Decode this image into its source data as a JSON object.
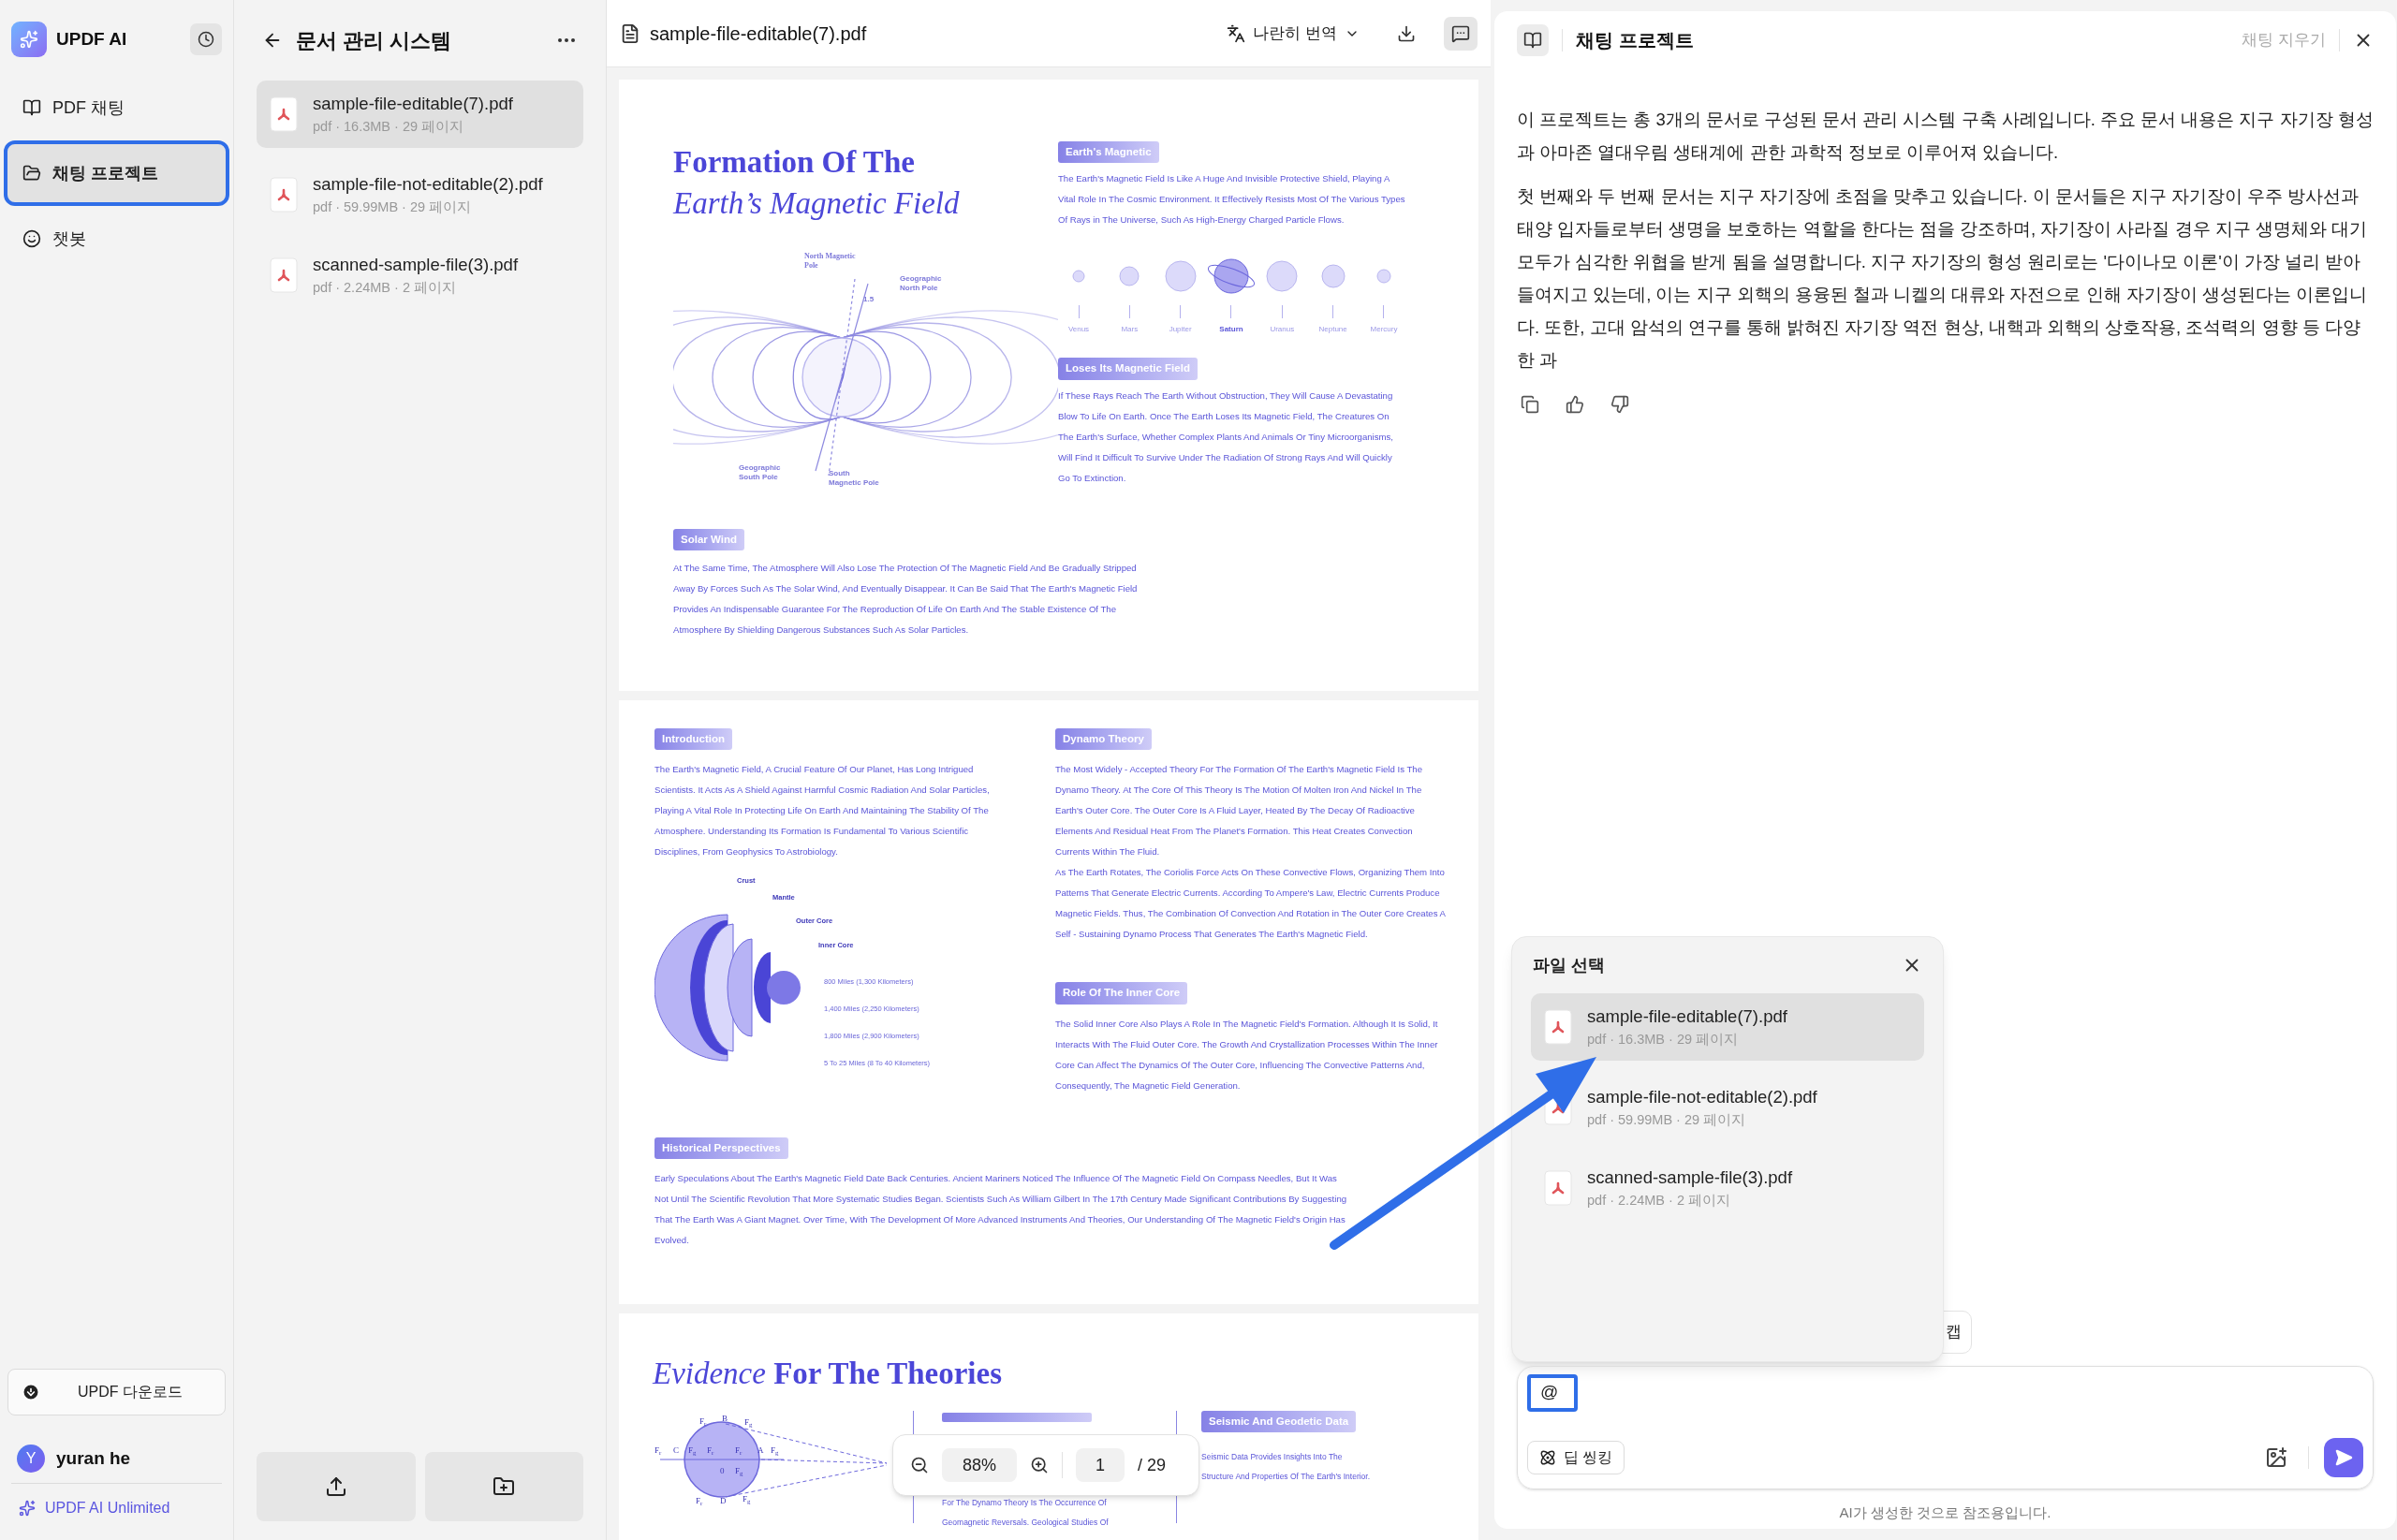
{
  "sidebar": {
    "app_name": "UPDF AI",
    "items": [
      {
        "label": "PDF 채팅",
        "kind": "book",
        "selected": false
      },
      {
        "label": "채팅 프로젝트",
        "kind": "folder",
        "selected": true
      },
      {
        "label": "챗봇",
        "kind": "bot",
        "selected": false
      }
    ],
    "download_button": "UPDF 다운로드",
    "user": {
      "initial": "Y",
      "name": "yuran he"
    },
    "plan": "UPDF AI Unlimited"
  },
  "project": {
    "title": "문서 관리 시스템",
    "files": [
      {
        "name": "sample-file-editable(7).pdf",
        "meta": "pdf · 16.3MB · 29 페이지",
        "selected": true
      },
      {
        "name": "sample-file-not-editable(2).pdf",
        "meta": "pdf · 59.99MB · 29 페이지",
        "selected": false
      },
      {
        "name": "scanned-sample-file(3).pdf",
        "meta": "pdf · 2.24MB · 2 페이지",
        "selected": false
      }
    ]
  },
  "viewer": {
    "file_name": "sample-file-editable(7).pdf",
    "translate_button": "나란히 번역",
    "zoom": "88%",
    "page": "1",
    "page_total": "/ 29",
    "page1": {
      "title": "Formation Of The",
      "subtitle": "Earth’s Magnetic Field",
      "diagram_labels": [
        "North Magnetic Pole",
        "Geographic North Pole",
        "1.5",
        "Geographic South Pole",
        "South Magnetic Pole"
      ],
      "sections": [
        {
          "heading": "Earth's Magnetic",
          "text": "The Earth's Magnetic Field Is Like A Huge And Invisible Protective Shield, Playing A Vital Role In The Cosmic Environment. It Effectively Resists Most Of The Various Types Of Rays in The Universe, Such As High-Energy Charged Particle Flows."
        },
        {
          "heading": "Loses Its Magnetic Field",
          "text": "If These Rays Reach The Earth Without Obstruction, They Will Cause A Devastating Blow To Life On Earth. Once The Earth Loses Its Magnetic Field, The Creatures On The Earth's Surface, Whether Complex Plants And Animals Or Tiny Microorganisms, Will Find It Difficult To Survive Under The Radiation Of Strong Rays And Will Quickly Go To Extinction."
        },
        {
          "heading": "Solar Wind",
          "text": "At The Same Time, The Atmosphere Will Also Lose The Protection Of The Magnetic Field And Be Gradually Stripped Away By Forces Such As The Solar Wind, And Eventually Disappear. It Can Be Said That The Earth's Magnetic Field Provides An Indispensable Guarantee For The Reproduction Of Life On Earth And The Stable Existence Of The Atmosphere By Shielding Dangerous Substances Such As Solar Particles."
        }
      ],
      "planets": [
        {
          "name": "Venus",
          "highlighted": false
        },
        {
          "name": "Mars",
          "highlighted": false
        },
        {
          "name": "Jupiter",
          "highlighted": false
        },
        {
          "name": "Saturn",
          "highlighted": true
        },
        {
          "name": "Uranus",
          "highlighted": false
        },
        {
          "name": "Neptune",
          "highlighted": false
        },
        {
          "name": "Mercury",
          "highlighted": false
        }
      ]
    },
    "page2": {
      "sections": [
        {
          "heading": "Introduction",
          "paragraphs": [
            "The Earth's Magnetic Field, A Crucial Feature Of Our Planet, Has Long Intrigued Scientists. It Acts As A Shield Against Harmful Cosmic Radiation And Solar Particles, Playing A Vital Role In Protecting Life On Earth And Maintaining The Stability Of The Atmosphere. Understanding Its Formation Is Fundamental To Various Scientific Disciplines, From Geophysics To Astrobiology."
          ]
        },
        {
          "heading": "Dynamo Theory",
          "paragraphs": [
            "The Most Widely - Accepted Theory For The Formation Of The Earth's Magnetic Field Is The Dynamo Theory. At The Core Of This Theory Is The Motion Of Molten Iron And Nickel In The Earth's Outer Core. The Outer Core Is A Fluid Layer, Heated By The Decay Of Radioactive Elements And Residual Heat From The Planet's Formation. This Heat Creates Convection Currents Within The Fluid.",
            "As The Earth Rotates, The Coriolis Force Acts On These Convective Flows, Organizing Them Into Patterns That Generate Electric Currents. According To Ampere's Law, Electric Currents Produce Magnetic Fields. Thus, The Combination Of Convection And Rotation in The Outer Core Creates A Self - Sustaining Dynamo Process That Generates The Earth's Magnetic Field."
          ]
        },
        {
          "heading": "Role Of The Inner Core",
          "paragraphs": [
            "The Solid Inner Core Also Plays A Role In The Magnetic Field's Formation. Although It Is Solid, It Interacts With The Fluid Outer Core. The Growth And Crystallization Processes Within The Inner Core Can Affect The Dynamics Of The Outer Core, Influencing The Convective Patterns And, Consequently, The Magnetic Field Generation."
          ]
        },
        {
          "heading": "Historical Perspectives",
          "paragraphs": [
            "Early Speculations About The Earth's Magnetic Field Date Back Centuries. Ancient Mariners Noticed The Influence Of The Magnetic Field On Compass Needles, But It Was Not Until The Scientific Revolution That More Systematic Studies Began. Scientists Such As William Gilbert In The 17th Century Made Significant Contributions By Suggesting That The Earth Was A Giant Magnet. Over Time, With The Development Of More Advanced Instruments And Theories, Our Understanding Of The Magnetic Field's Origin Has Evolved."
          ]
        }
      ],
      "layer_labels": [
        "Crust",
        "Mantle",
        "Outer Core",
        "Inner Core"
      ],
      "distances": [
        "800 Miles (1,300 Kilometers)",
        "1,400 Miles (2,250 Kilometers)",
        "1,800 Miles (2,900 Kilometers)",
        "5 To 25 Miles (8 To 40 Kilometers)"
      ]
    },
    "page3": {
      "title": "*Evidence* **For The Theories**",
      "force_labels": [
        "F$_{r}$",
        "B",
        "F$_{g}$",
        "F$_{r}$",
        "C",
        "F$_{g}$",
        "F$_{r}$",
        "F$_{r}$",
        "A",
        "F$_{g}$",
        "0",
        "F$_{g}$",
        "F$_{r}$",
        "D",
        "F$_{g}$"
      ],
      "middle_lines": [
        "For The Dynamo Theory Is The Occurrence Of",
        "Geomagnetic Reversals. Geological Studies Of"
      ],
      "right_heading": "Seismic And Geodetic Data",
      "right_lines": [
        "Seismic Data Provides Insights Into The",
        "Structure And Properties Of The Earth's Interior."
      ]
    }
  },
  "chat": {
    "title": "채팅 프로젝트",
    "clear_button": "채팅 지우기",
    "paragraphs": [
      "이 프로젝트는 총 3개의 문서로 구성된 문서 관리 시스템 구축 사례입니다. 주요 문서 내용은 지구 자기장 형성과 아마존 열대우림 생태계에 관한 과학적 정보로 이루어져 있습니다.",
      "첫 번째와 두 번째 문서는 지구 자기장에 초점을 맞추고 있습니다. 이 문서들은 지구 자기장이 우주 방사선과 태양 입자들로부터 생명을 보호하는 역할을 한다는 점을 강조하며, 자기장이 사라질 경우 지구 생명체와 대기 모두가 심각한 위협을 받게 됨을 설명합니다. 지구 자기장의 형성 원리로는 '다이나모 이론'이 가장 널리 받아들여지고 있는데, 이는 지구 외핵의 용융된 철과 니켈의 대류와 자전으로 인해 자기장이 생성된다는 이론입니다. 또한, 고대 암석의 연구를 통해 밝혀진 자기장 역전 현상, 내핵과 외핵의 상호작용, 조석력의 영향 등 다양한 과"
    ],
    "file_picker": {
      "title": "파일 선택",
      "files": [
        {
          "name": "sample-file-editable(7).pdf",
          "meta": "pdf · 16.3MB · 29 페이지",
          "selected": true
        },
        {
          "name": "sample-file-not-editable(2).pdf",
          "meta": "pdf · 59.99MB · 29 페이지",
          "selected": false
        },
        {
          "name": "scanned-sample-file(3).pdf",
          "meta": "pdf · 2.24MB · 2 페이지",
          "selected": false
        }
      ]
    },
    "hidden_chip": "캡",
    "input": {
      "value": "@"
    },
    "deep_thinking_button": "딥 씽킹",
    "footer": "AI가 생성한 것으로 참조용입니다."
  }
}
